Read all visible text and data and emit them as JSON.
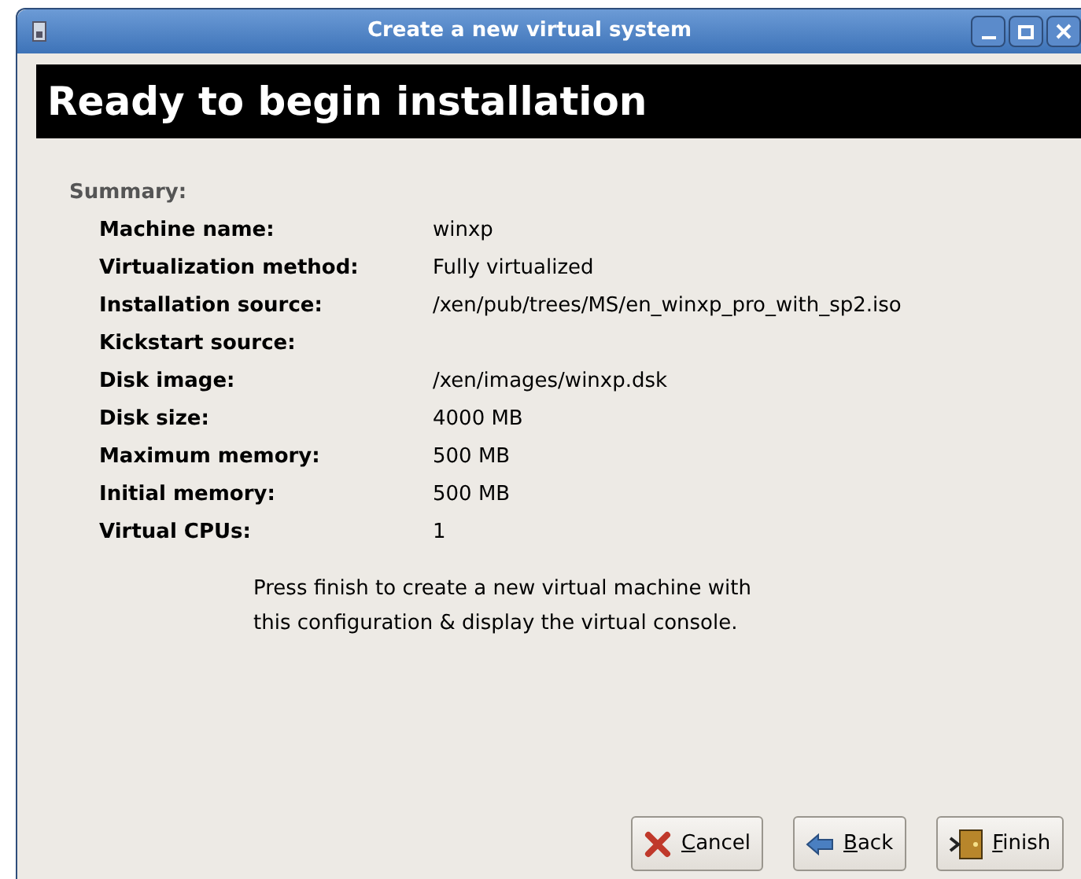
{
  "window": {
    "title": "Create a new virtual system"
  },
  "header": {
    "title": "Ready to begin installation"
  },
  "summary": {
    "heading": "Summary:",
    "rows": [
      {
        "label": "Machine name:",
        "value": "winxp"
      },
      {
        "label": "Virtualization method:",
        "value": "Fully virtualized"
      },
      {
        "label": "Installation source:",
        "value": "/xen/pub/trees/MS/en_winxp_pro_with_sp2.iso"
      },
      {
        "label": "Kickstart source:"
      },
      {
        "label": "Disk image:",
        "value": "/xen/images/winxp.dsk"
      },
      {
        "label": "Disk size:",
        "value": "4000 MB"
      },
      {
        "label": "Maximum memory:",
        "value": "500 MB"
      },
      {
        "label": "Initial memory:",
        "value": "500 MB"
      },
      {
        "label": "Virtual CPUs:",
        "value": "1"
      }
    ]
  },
  "message": [
    "Press finish to create a new virtual machine with",
    "this configuration & display the virtual console."
  ],
  "buttons": [
    {
      "kind": "cancel",
      "label": "Cancel",
      "mnemonic": true
    },
    {
      "kind": "back",
      "label": "Back",
      "mnemonic": true
    },
    {
      "kind": "finish",
      "label": "Finish",
      "mnemonic": true
    }
  ]
}
